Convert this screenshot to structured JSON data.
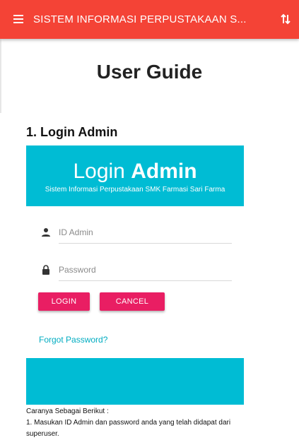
{
  "header": {
    "title": "SISTEM INFORMASI PERPUSTAKAAN S...",
    "menu_icon": "hamburger-menu-icon",
    "sort_icon": "swap-vertical-icon",
    "bg_color": "#f44336"
  },
  "page": {
    "title": "User Guide",
    "section_title": "1. Login Admin"
  },
  "login_preview": {
    "heading_light": "Login",
    "heading_bold": "Admin",
    "subtitle": "Sistem Informasi Perpustakaan SMK Farmasi Sari Farma",
    "id_placeholder": "ID Admin",
    "password_placeholder": "Password",
    "login_label": "LOGIN",
    "cancel_label": "CANCEL",
    "forgot_label": "Forgot Password?",
    "accent_color": "#00bcd4",
    "button_color": "#e91e63"
  },
  "instructions": {
    "intro": "Caranya Sebagai Berikut :",
    "step1": "1. Masukan ID Admin dan password anda yang telah didapat dari superuser."
  }
}
